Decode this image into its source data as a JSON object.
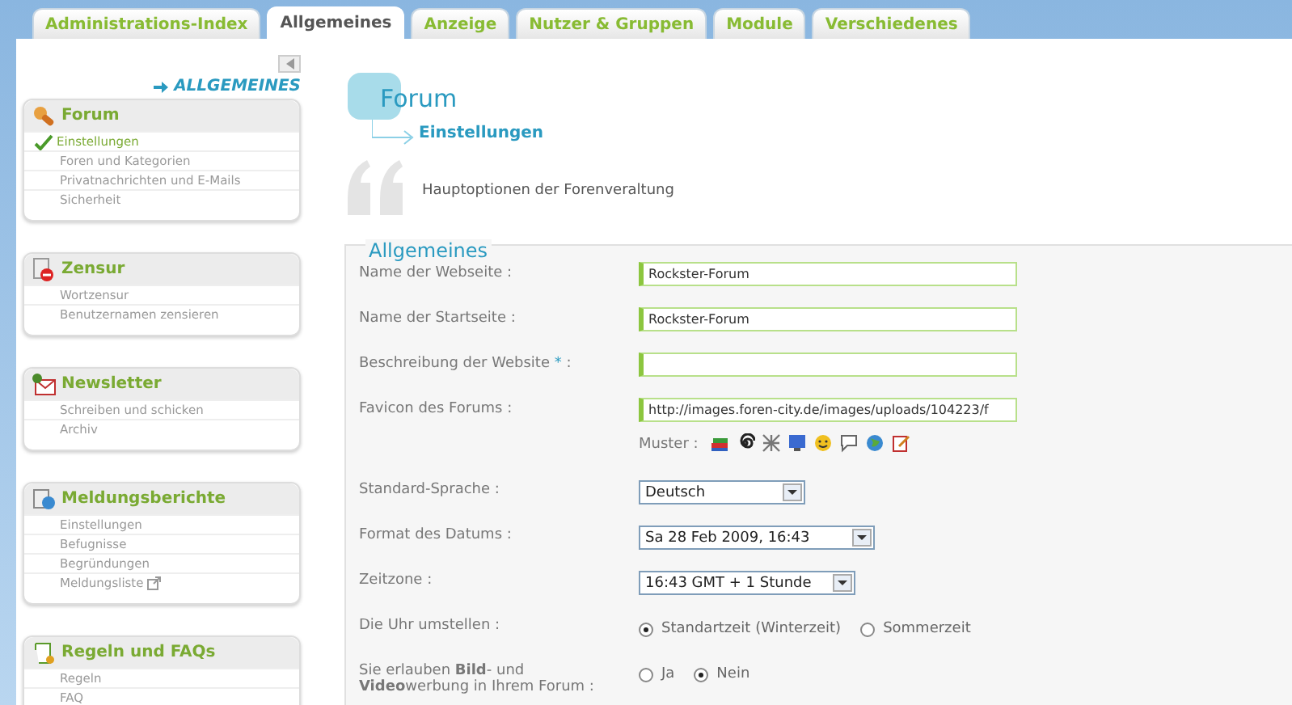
{
  "tabs": [
    {
      "label": "Administrations-Index",
      "selected": false
    },
    {
      "label": "Allgemeines",
      "selected": true
    },
    {
      "label": "Anzeige",
      "selected": false
    },
    {
      "label": "Nutzer & Gruppen",
      "selected": false
    },
    {
      "label": "Module",
      "selected": false
    },
    {
      "label": "Verschiedenes",
      "selected": false
    }
  ],
  "sidebar": {
    "section_title": "ALLGEMEINES",
    "groups": [
      {
        "title": "Forum",
        "items": [
          {
            "label": "Einstellungen",
            "selected": true,
            "external": false
          },
          {
            "label": "Foren und Kategorien",
            "selected": false,
            "external": false
          },
          {
            "label": "Privatnachrichten und E-Mails",
            "selected": false,
            "external": false
          },
          {
            "label": "Sicherheit",
            "selected": false,
            "external": false
          }
        ]
      },
      {
        "title": "Zensur",
        "items": [
          {
            "label": "Wortzensur",
            "selected": false,
            "external": false
          },
          {
            "label": "Benutzernamen zensieren",
            "selected": false,
            "external": false
          }
        ]
      },
      {
        "title": "Newsletter",
        "items": [
          {
            "label": "Schreiben und schicken",
            "selected": false,
            "external": false
          },
          {
            "label": "Archiv",
            "selected": false,
            "external": false
          }
        ]
      },
      {
        "title": "Meldungsberichte",
        "items": [
          {
            "label": "Einstellungen",
            "selected": false,
            "external": false
          },
          {
            "label": "Befugnisse",
            "selected": false,
            "external": false
          },
          {
            "label": "Begründungen",
            "selected": false,
            "external": false
          },
          {
            "label": "Meldungsliste",
            "selected": false,
            "external": true
          }
        ]
      },
      {
        "title": "Regeln und FAQs",
        "items": [
          {
            "label": "Regeln",
            "selected": false,
            "external": false
          },
          {
            "label": "FAQ",
            "selected": false,
            "external": false
          }
        ]
      }
    ]
  },
  "main": {
    "title": "Forum",
    "subtitle": "Einstellungen",
    "description": "Hauptoptionen der Forenveraltung",
    "fieldset": {
      "legend": "Allgemeines",
      "rows": [
        {
          "kind": "text",
          "label": "Name der Webseite :",
          "value": "Rockster-Forum"
        },
        {
          "kind": "text",
          "label": "Name der Startseite :",
          "value": "Rockster-Forum"
        },
        {
          "kind": "text",
          "label": "Beschreibung der Website",
          "required_mark": "*",
          "label_end": ":",
          "value": ""
        },
        {
          "kind": "text",
          "label": "Favicon des Forums :",
          "value": "http://images.foren-city.de/images/uploads/104223/f"
        },
        {
          "kind": "samples",
          "label": "Muster :"
        },
        {
          "kind": "select",
          "label": "Standard-Sprache :",
          "value": "Deutsch"
        },
        {
          "kind": "select",
          "label": "Format des Datums :",
          "value": "Sa 28 Feb 2009, 16:43"
        },
        {
          "kind": "select",
          "label": "Zeitzone :",
          "value": "16:43 GMT + 1 Stunde"
        },
        {
          "kind": "radio",
          "label": "Die Uhr umstellen :",
          "options": [
            {
              "label": "Standartzeit (Winterzeit)",
              "selected": true
            },
            {
              "label": "Sommerzeit",
              "selected": false
            }
          ]
        },
        {
          "kind": "radio",
          "label": "Sie erlauben **Bild**- und **Video**werbung in Ihrem Forum :",
          "options": [
            {
              "label": "Ja",
              "selected": false
            },
            {
              "label": "Nein",
              "selected": true
            }
          ]
        }
      ]
    }
  }
}
